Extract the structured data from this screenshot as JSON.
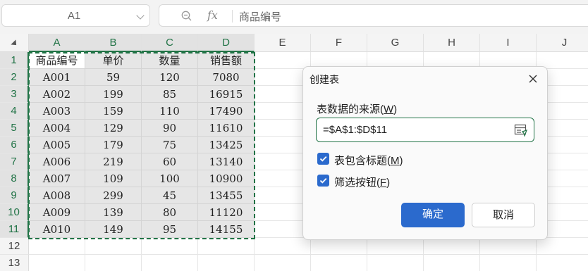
{
  "formula_bar": {
    "name_box": "A1",
    "formula": "商品编号",
    "fx_label": "fx"
  },
  "columns": [
    "A",
    "B",
    "C",
    "D",
    "E",
    "F",
    "G",
    "H",
    "I",
    "J"
  ],
  "rows": [
    "1",
    "2",
    "3",
    "4",
    "5",
    "6",
    "7",
    "8",
    "9",
    "10",
    "11",
    "12",
    "13"
  ],
  "table": [
    [
      "商品编号",
      "单价",
      "数量",
      "销售额"
    ],
    [
      "A001",
      "59",
      "120",
      "7080"
    ],
    [
      "A002",
      "199",
      "85",
      "16915"
    ],
    [
      "A003",
      "159",
      "110",
      "17490"
    ],
    [
      "A004",
      "129",
      "90",
      "11610"
    ],
    [
      "A005",
      "179",
      "75",
      "13425"
    ],
    [
      "A006",
      "219",
      "60",
      "13140"
    ],
    [
      "A007",
      "109",
      "100",
      "10900"
    ],
    [
      "A008",
      "299",
      "45",
      "13455"
    ],
    [
      "A009",
      "139",
      "80",
      "11120"
    ],
    [
      "A010",
      "149",
      "95",
      "14155"
    ]
  ],
  "dialog": {
    "title": "创建表",
    "source_label": "表数据的来源(",
    "source_label_key": "W",
    "source_label_end": ")",
    "source_value": "=$A$1:$D$11",
    "has_headers_label": "表包含标题(",
    "has_headers_key": "M",
    "has_headers_end": ")",
    "has_headers_checked": true,
    "filter_label": "筛选按钮(",
    "filter_key": "F",
    "filter_end": ")",
    "filter_checked": true,
    "ok_label": "确定",
    "cancel_label": "取消"
  },
  "colors": {
    "selection_green": "#217346",
    "primary_blue": "#2b6acd"
  }
}
